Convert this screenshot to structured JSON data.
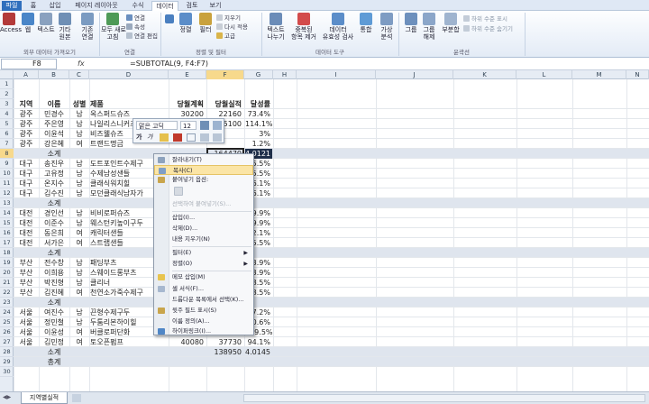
{
  "tabs": [
    {
      "label": "파일"
    },
    {
      "label": "홈"
    },
    {
      "label": "삽입"
    },
    {
      "label": "페이지 레이아웃"
    },
    {
      "label": "수식"
    },
    {
      "label": "데이터"
    },
    {
      "label": "검토"
    },
    {
      "label": "보기"
    }
  ],
  "ribbon": {
    "access": "Access",
    "web": "웹",
    "text": "텍스트",
    "other": "기타\n원본",
    "existing": "기존\n연결",
    "refresh": "모두 새로\n고침",
    "connections": "연결",
    "properties": "속성",
    "editlinks": "연결 편집",
    "sort": "정렬",
    "filter": "필터",
    "clear": "지우기",
    "reapply": "다시 적용",
    "advanced": "고급",
    "textcol": "텍스트\n나누기",
    "dupremove": "중복된\n항목 제거",
    "validation": "데이터\n유효성 검사",
    "consolidate": "통합",
    "whatif": "가상\n분석",
    "group": "그룹",
    "ungroup": "그룹\n해제",
    "subtotal": "부분합",
    "showdetail": "하위 수준 표시",
    "hidedetail": "하위 수준 숨기기",
    "grp_external": "외부 데이터 가져오기",
    "grp_conn": "연결",
    "grp_sort": "정렬 및 필터",
    "grp_tools": "데이터 도구",
    "grp_outline": "윤곽선"
  },
  "namebox": "F8",
  "fx": "fx",
  "formula": "=SUBTOTAL(9, F4:F7)",
  "columns": [
    "A",
    "B",
    "C",
    "D",
    "E",
    "F",
    "G",
    "H",
    "I",
    "J",
    "K",
    "L",
    "M",
    "N"
  ],
  "rownums": [
    "1",
    "2",
    "3",
    "4",
    "5",
    "6",
    "7",
    "8",
    "9",
    "10",
    "11",
    "12",
    "13",
    "14",
    "15",
    "16",
    "17",
    "18",
    "19",
    "20",
    "21",
    "22",
    "23",
    "24",
    "25",
    "26",
    "27",
    "28",
    "29",
    "30"
  ],
  "table": {
    "headers": [
      "지역",
      "이름",
      "성별",
      "제품",
      "당월계획",
      "당월실적",
      "달성률"
    ],
    "rows": [
      [
        "광주",
        "민경수",
        "남",
        "옥스퍼드슈즈",
        "30200",
        "22160",
        "73.4%"
      ],
      [
        "광주",
        "주은영",
        "남",
        "나일리스니커즈",
        "22000",
        "25100",
        "114.1%"
      ],
      [
        "광주",
        "이윤석",
        "남",
        "비즈웰슈즈",
        "",
        "",
        "3%"
      ],
      [
        "광주",
        "강은혜",
        "여",
        "트랜드명금",
        "",
        "",
        "1.2%"
      ],
      [
        "",
        "소계",
        "",
        "",
        "",
        "164470",
        "4.0121"
      ],
      [
        "대구",
        "송진우",
        "남",
        "도트포인트수제구",
        "",
        "",
        "5.5%"
      ],
      [
        "대구",
        "고유정",
        "남",
        "수제남성샌들",
        "",
        "",
        "5.5%"
      ],
      [
        "대구",
        "온지수",
        "남",
        "클래식워치힐",
        "",
        "",
        "6.1%"
      ],
      [
        "대구",
        "김수진",
        "남",
        "모던클래식남자가",
        "",
        "",
        "6.1%"
      ],
      [
        "",
        "소계",
        "",
        "",
        "",
        "",
        ""
      ],
      [
        "대전",
        "경인선",
        "남",
        "비비로퍼슈즈",
        "",
        "",
        "9.9%"
      ],
      [
        "대전",
        "이준수",
        "남",
        "웨스턴키높이구두",
        "",
        "",
        "9.9%"
      ],
      [
        "대전",
        "동은희",
        "여",
        "캐릭터샌들",
        "",
        "",
        "2.1%"
      ],
      [
        "대전",
        "서가은",
        "여",
        "스트랩샌들",
        "",
        "",
        "5.5%"
      ],
      [
        "",
        "소계",
        "",
        "",
        "",
        "",
        ""
      ],
      [
        "부산",
        "전수창",
        "남",
        "패딩부츠",
        "",
        "",
        "3.9%"
      ],
      [
        "부산",
        "이희용",
        "남",
        "스웨이드롱부츠",
        "",
        "",
        "3.9%"
      ],
      [
        "부산",
        "박진형",
        "남",
        "클리너",
        "",
        "",
        "8.5%"
      ],
      [
        "부산",
        "김진혜",
        "여",
        "천연소가죽수제구",
        "",
        "",
        "8.5%"
      ],
      [
        "",
        "소계",
        "",
        "",
        "",
        "",
        ""
      ],
      [
        "서울",
        "여진수",
        "남",
        "끈형수제구두",
        "",
        "",
        "7.2%"
      ],
      [
        "서울",
        "정민철",
        "남",
        "두툼리본하이힐",
        "22810",
        "20670",
        "90.6%"
      ],
      [
        "서울",
        "이윤성",
        "여",
        "버클로퍼단화",
        "40030",
        "43850",
        "109.5%"
      ],
      [
        "서울",
        "김민정",
        "여",
        "토오픈펌프",
        "40080",
        "37730",
        "94.1%"
      ],
      [
        "",
        "소계",
        "",
        "",
        "",
        "138950",
        "4.0145"
      ],
      [
        "",
        "총계",
        "",
        "",
        "",
        "",
        ""
      ]
    ]
  },
  "mini": {
    "font": "맑은 고딕",
    "size": "12",
    "bold": "가",
    "italic": "가"
  },
  "menu": [
    {
      "label": "잘라내기(T)"
    },
    {
      "label": "복사(C)"
    },
    {
      "label": "붙여넣기 옵션:"
    },
    {
      "label": ""
    },
    {
      "label": "선택하여 붙여넣기(S)..."
    },
    {
      "label": "삽입(I)..."
    },
    {
      "label": "삭제(D)..."
    },
    {
      "label": "내용 지우기(N)"
    },
    {
      "label": "필터(E)"
    },
    {
      "label": "정렬(O)"
    },
    {
      "label": "메모 삽입(M)"
    },
    {
      "label": "셀 서식(F)..."
    },
    {
      "label": "드롭다운 목록에서 선택(K)..."
    },
    {
      "label": "윗주 필드 표시(S)"
    },
    {
      "label": "이름 정의(A)..."
    },
    {
      "label": "하이퍼링크(I)..."
    }
  ],
  "sheet_tab": "지역별실적",
  "colors": {
    "accent": "#2f6fbd",
    "highlight": "#fbe5a6",
    "subtotal_row": "#dfe5ee"
  }
}
